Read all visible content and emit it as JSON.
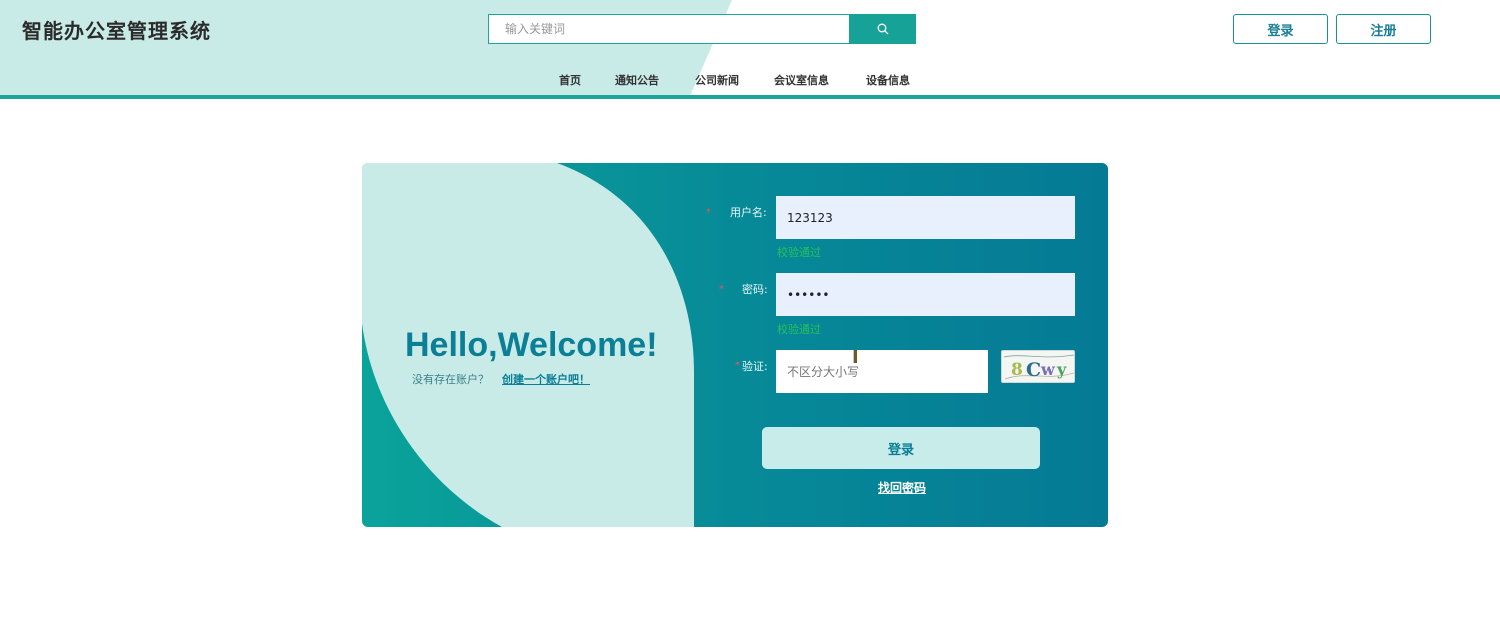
{
  "header": {
    "site_title": "智能办公室管理系统",
    "search_placeholder": "输入关键词",
    "login_label": "登录",
    "register_label": "注册"
  },
  "nav": {
    "items": [
      {
        "label": "首页"
      },
      {
        "label": "通知公告"
      },
      {
        "label": "公司新闻"
      },
      {
        "label": "会议室信息"
      },
      {
        "label": "设备信息"
      }
    ]
  },
  "welcome": {
    "heading": "Hello,Welcome!",
    "no_account_text": "没有存在账户？",
    "create_link": "创建一个账户吧！"
  },
  "form": {
    "username_label": "用户名:",
    "username_value": "123123",
    "username_status": "校验通过",
    "password_label": "密码:",
    "password_value": "••••••",
    "password_status": "校验通过",
    "captcha_label": "验证:",
    "captcha_placeholder": "不区分大小写",
    "captcha_text": "8Cwy",
    "submit_label": "登录",
    "forgot_label": "找回密码"
  },
  "colors": {
    "accent": "#1aa69a",
    "brand_dark": "#0b7f96",
    "valid": "#27c15a"
  },
  "icons": {
    "search": "search-icon",
    "cursor": "text-cursor-icon"
  }
}
